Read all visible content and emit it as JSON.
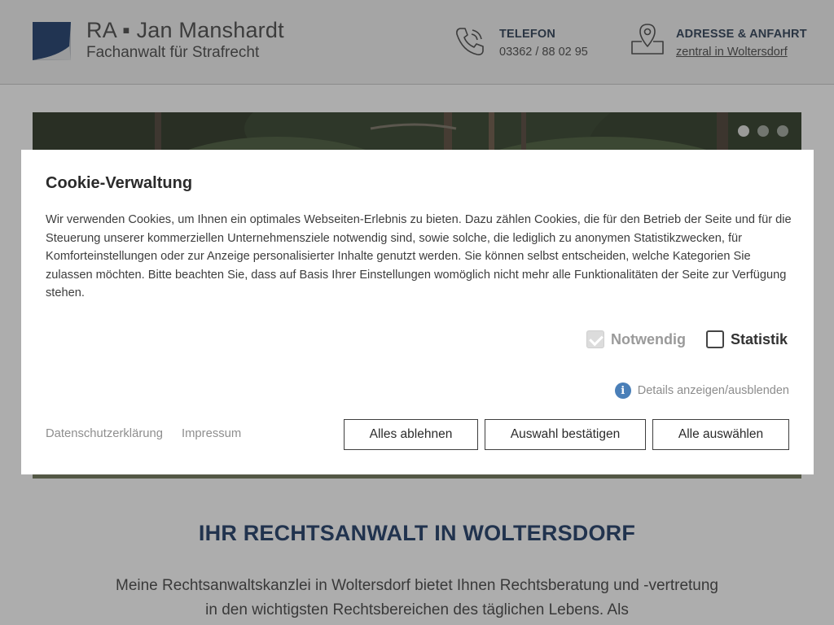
{
  "header": {
    "logo_title": "RA ▪ Jan Manshardt",
    "logo_subtitle": "Fachanwalt für Strafrecht",
    "phone": {
      "label": "TELEFON",
      "value": "03362 / 88 02 95"
    },
    "address": {
      "label": "ADRESSE & ANFAHRT",
      "value": "zentral in Woltersdorf"
    }
  },
  "hero": {
    "slides": 3,
    "active_slide": 1
  },
  "cookie_modal": {
    "title": "Cookie-Verwaltung",
    "text": "Wir verwenden Cookies, um Ihnen ein optimales Webseiten-Erlebnis zu bieten. Dazu zählen Cookies, die für den Betrieb der Seite und für die Steuerung unserer kommerziellen Unternehmensziele notwendig sind, sowie solche, die lediglich zu anonymen Statistikzwecken, für Komforteinstellungen oder zur Anzeige personalisierter Inhalte genutzt werden. Sie können selbst entscheiden, welche Kategorien Sie zulassen möchten. Bitte beachten Sie, dass auf Basis Ihrer Einstellungen womöglich nicht mehr alle Funktionalitäten der Seite zur Verfügung stehen.",
    "options": {
      "required": {
        "label": "Notwendig",
        "checked": true,
        "disabled": true
      },
      "statistics": {
        "label": "Statistik",
        "checked": false,
        "disabled": false
      }
    },
    "details_link": "Details anzeigen/ausblenden",
    "privacy_link": "Datenschutzerklärung",
    "imprint_link": "Impressum",
    "buttons": {
      "reject": "Alles ablehnen",
      "confirm": "Auswahl bestätigen",
      "accept_all": "Alle auswählen"
    }
  },
  "content": {
    "title": "IHR RECHTSANWALT IN WOLTERSDORF",
    "text": "Meine Rechtsanwaltskanzlei in Woltersdorf bietet Ihnen Rechtsberatung und -vertretung in den wichtigsten Rechtsbereichen des täglichen Lebens. Als"
  },
  "colors": {
    "brand_blue": "#1d3a66",
    "info_icon": "#4a7fb8"
  }
}
